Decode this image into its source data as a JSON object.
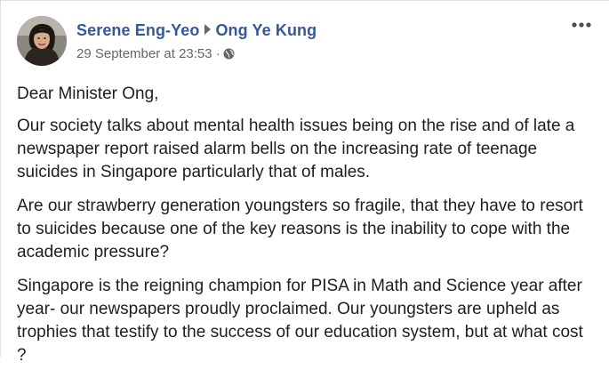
{
  "post": {
    "author": "Serene Eng-Yeo",
    "recipient": "Ong Ye Kung",
    "timestamp": "29 September at 23:53",
    "separator": "·",
    "privacy_icon": "globe-icon",
    "more_icon": "more-options-icon",
    "avatar_icon": "profile-photo",
    "paragraphs": [
      "Dear Minister Ong,",
      "Our society talks about mental health issues being on the rise and of late a newspaper report raised alarm bells on the increasing rate of teenage suicides in Singapore particularly that of males.",
      "Are our strawberry generation youngsters so fragile, that they have to resort to suicides because one of the key reasons is the inability to cope with the academic pressure?",
      "Singapore is the reigning champion for PISA in Math and Science year after year- our newspapers proudly proclaimed. Our youngsters are upheld as trophies that testify to the success of our education system, but at what cost ?"
    ]
  },
  "colors": {
    "name_link": "#365899",
    "meta_text": "#616770",
    "body_text": "#1c1e21"
  }
}
